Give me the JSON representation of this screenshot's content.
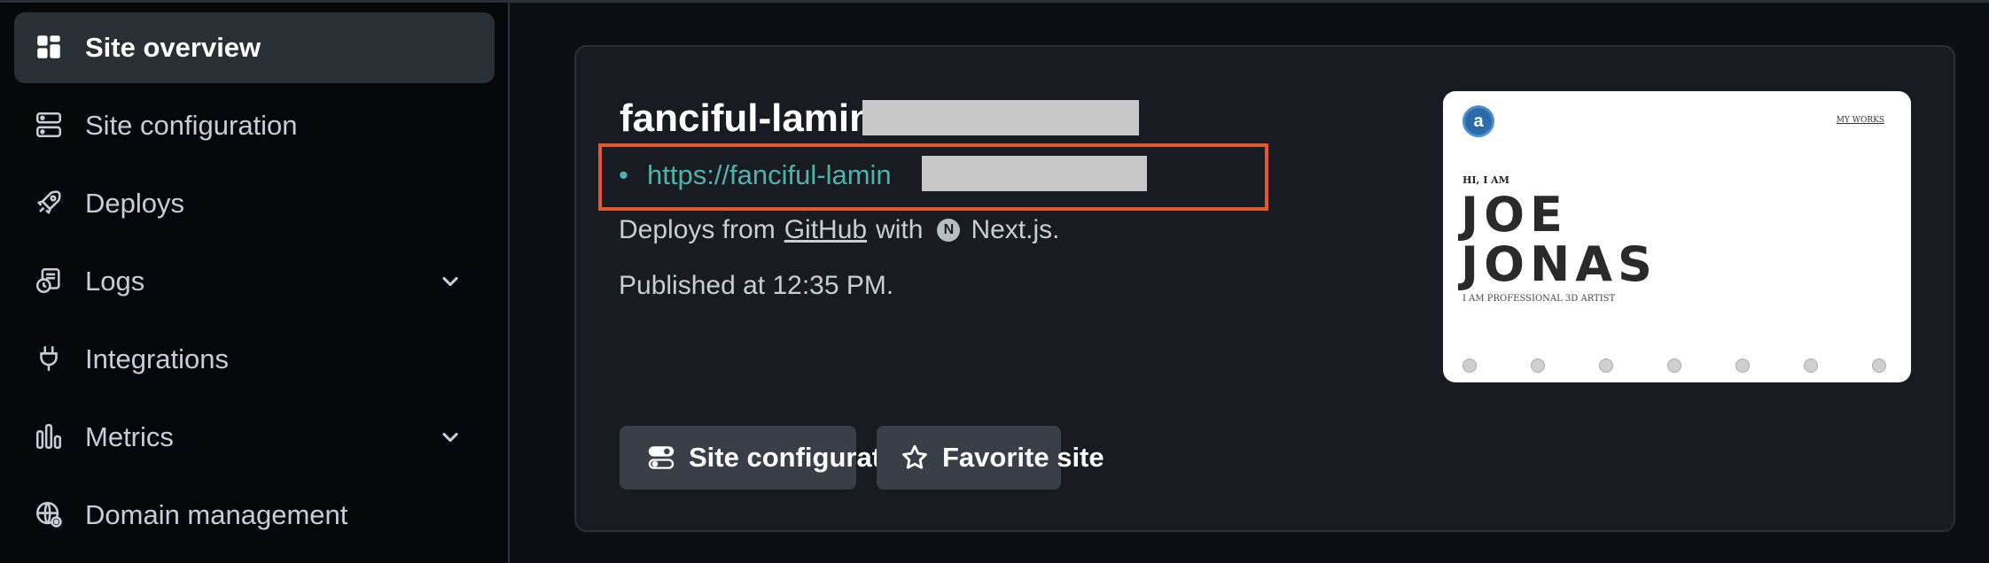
{
  "sidebar": {
    "items": [
      {
        "label": "Site overview",
        "icon": "grid-icon",
        "active": true
      },
      {
        "label": "Site configuration",
        "icon": "server-icon"
      },
      {
        "label": "Deploys",
        "icon": "rocket-icon"
      },
      {
        "label": "Logs",
        "icon": "logs-icon",
        "has_chevron": true
      },
      {
        "label": "Integrations",
        "icon": "plug-icon"
      },
      {
        "label": "Metrics",
        "icon": "bar-chart-icon",
        "has_chevron": true
      },
      {
        "label": "Domain management",
        "icon": "globe-icon"
      }
    ]
  },
  "site": {
    "title": "fanciful-lamin",
    "url": "https://fanciful-lamin",
    "deploys_prefix": "Deploys from",
    "deploys_source": "GitHub",
    "deploys_with": "with",
    "framework": "Next.js.",
    "published": "Published at 12:35 PM."
  },
  "buttons": {
    "site_configuration": "Site configuration",
    "favorite_site": "Favorite site"
  },
  "preview": {
    "nav_link": "MY WORKS",
    "greeting": "HI, I AM",
    "name_line1": "JOE",
    "name_line2": "JONAS",
    "subtitle": "I AM PROFESSIONAL 3D ARTIST"
  },
  "colors": {
    "accent_link": "#4fb3a9",
    "highlight_border": "#e25a2a",
    "card_bg": "#181b21",
    "sidebar_active_bg": "#2a2f36"
  }
}
